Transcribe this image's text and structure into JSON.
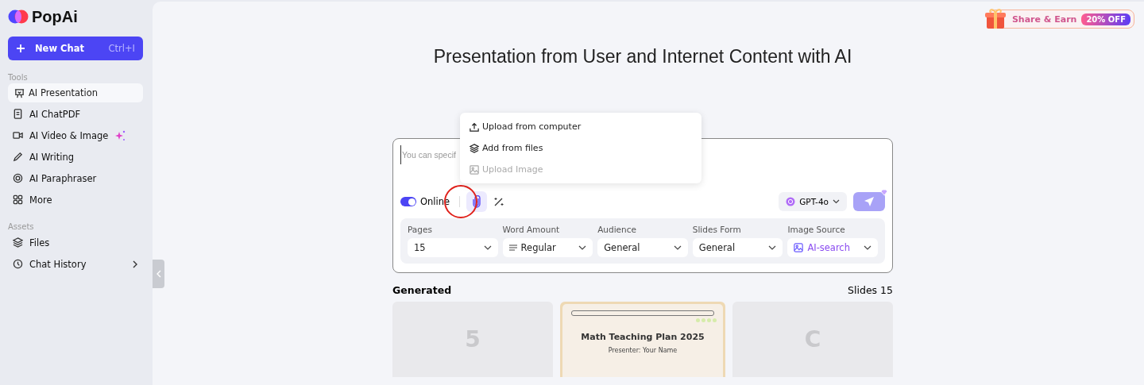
{
  "logo": {
    "text": "PopAi"
  },
  "new_chat": {
    "label": "New Chat",
    "shortcut": "Ctrl+I"
  },
  "sidebar": {
    "sections": [
      {
        "title": "Tools",
        "items": [
          {
            "label": "AI Presentation",
            "selected": true,
            "sparkle": false,
            "expandable": false
          },
          {
            "label": "AI ChatPDF",
            "selected": false,
            "sparkle": false,
            "expandable": false
          },
          {
            "label": "AI Video & Image",
            "selected": false,
            "sparkle": true,
            "expandable": false
          },
          {
            "label": "AI Writing",
            "selected": false,
            "sparkle": false,
            "expandable": false
          },
          {
            "label": "AI Paraphraser",
            "selected": false,
            "sparkle": false,
            "expandable": false
          },
          {
            "label": "More",
            "selected": false,
            "sparkle": false,
            "expandable": false
          }
        ]
      },
      {
        "title": "Assets",
        "items": [
          {
            "label": "Files",
            "selected": false,
            "sparkle": false,
            "expandable": false
          },
          {
            "label": "Chat History",
            "selected": false,
            "sparkle": false,
            "expandable": true
          }
        ]
      }
    ]
  },
  "promo": {
    "label": "Share & Earn",
    "badge": "20% OFF"
  },
  "title": "Presentation from User and Internet Content with AI",
  "composer": {
    "placeholder": "You can specif",
    "online": {
      "label": "Online",
      "on": true
    },
    "attach_active": true,
    "model": "GPT-4o",
    "attach_menu": [
      {
        "label": "Upload from computer",
        "disabled": false
      },
      {
        "label": "Add from files",
        "disabled": false
      },
      {
        "label": "Upload Image",
        "disabled": true
      }
    ]
  },
  "options": [
    {
      "label": "Pages",
      "value": "15",
      "accent": false
    },
    {
      "label": "Word Amount",
      "value": "Regular",
      "accent": false
    },
    {
      "label": "Audience",
      "value": "General",
      "accent": false
    },
    {
      "label": "Slides Form",
      "value": "General",
      "accent": false
    },
    {
      "label": "Image Source",
      "value": "AI-search",
      "accent": true
    }
  ],
  "generated": {
    "title": "Generated",
    "count": "Slides 15"
  },
  "cards": [
    {
      "kind": "placeholder",
      "glyph": "5"
    },
    {
      "kind": "slide",
      "title": "Math Teaching Plan 2025",
      "subtitle": "Presenter: Your Name"
    },
    {
      "kind": "placeholder",
      "glyph": "C"
    }
  ]
}
